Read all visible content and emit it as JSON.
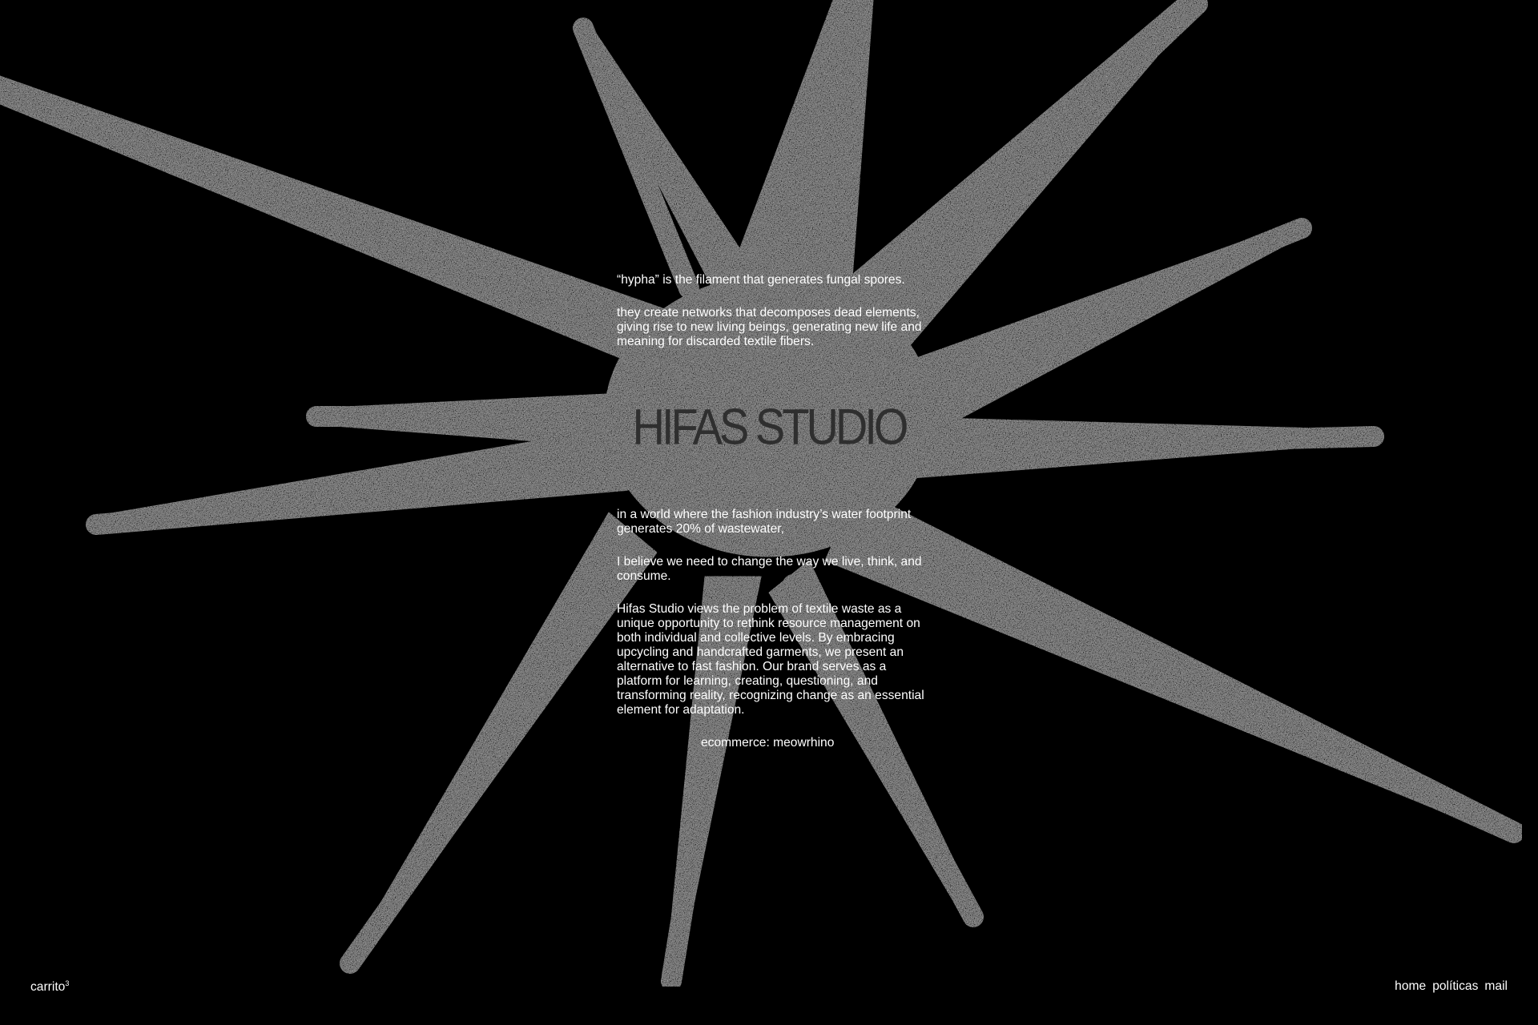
{
  "brand": {
    "logo_text": "HIFAS STUDIO"
  },
  "intro": {
    "definition": "“hypha” is the filament that generates fungal spores.",
    "networks": "they create networks that decomposes dead elements, giving rise to new living beings, generating new life and meaning for discarded textile fibers."
  },
  "manifesto": {
    "footprint": "in a world where the fashion industry’s water footprint generates 20% of wastewater,",
    "belief": "I believe we need to change the way we live, think, and consume.",
    "mission": "Hifas Studio views the problem of textile waste as a unique opportunity to rethink resource management on both individual and collective levels. By embracing upcycling and handcrafted garments, we present an alternative to fast fashion. Our brand serves as a platform for learning, creating, questioning, and transforming reality, recognizing change as an essential element for adaptation.",
    "ecommerce_link": "ecommerce: meowrhino"
  },
  "cart": {
    "label": "carrito",
    "count": "3"
  },
  "nav": {
    "home": "home",
    "policies": "políticas",
    "mail": "mail"
  },
  "colors": {
    "background": "#000000",
    "text": "#ffffff",
    "star_shape": "#2a2a2a",
    "logo": "#2f2f2f"
  }
}
